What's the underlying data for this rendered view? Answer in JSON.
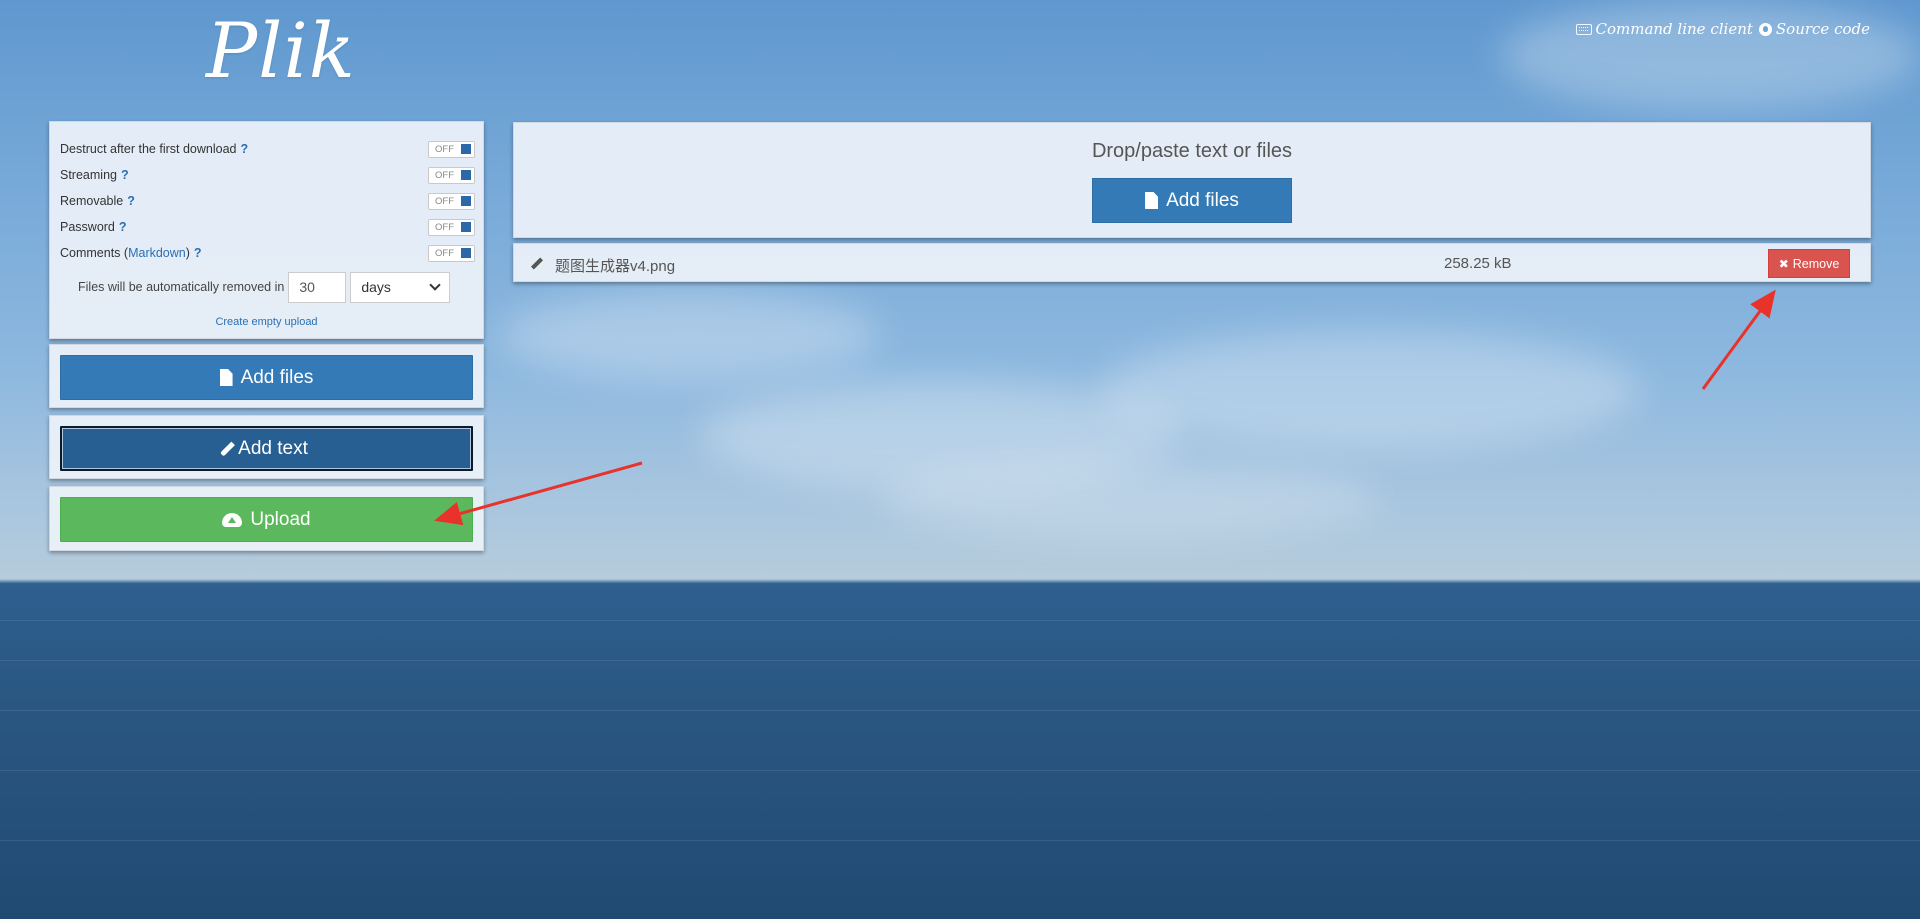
{
  "header": {
    "logo": "Plik",
    "links": [
      {
        "icon": "keyboard-icon",
        "label": "Command line client"
      },
      {
        "icon": "github-icon",
        "label": "Source code"
      }
    ]
  },
  "settings": {
    "options": [
      {
        "label": "Destruct after the first download",
        "state": "OFF"
      },
      {
        "label": "Streaming",
        "state": "OFF"
      },
      {
        "label": "Removable",
        "state": "OFF"
      },
      {
        "label": "Password",
        "state": "OFF"
      },
      {
        "label_prefix": "Comments (",
        "link": "Markdown",
        "label_suffix": ")",
        "state": "OFF"
      }
    ],
    "help_mark": "?",
    "ttl": {
      "label": "Files will be automatically removed in",
      "value": "30",
      "unit": "days"
    },
    "empty_upload_link": "Create empty upload"
  },
  "actions": {
    "add_files": "Add files",
    "add_text": "Add text",
    "upload": "Upload"
  },
  "dropzone": {
    "text": "Drop/paste text or files",
    "add_files": "Add files"
  },
  "files": [
    {
      "name": "题图生成器v4.png",
      "size": "258.25 kB",
      "remove_label": "Remove"
    }
  ],
  "colors": {
    "primary": "#337ab7",
    "success": "#5cb85c",
    "danger": "#d9534f",
    "annotation": "#e8322a"
  }
}
